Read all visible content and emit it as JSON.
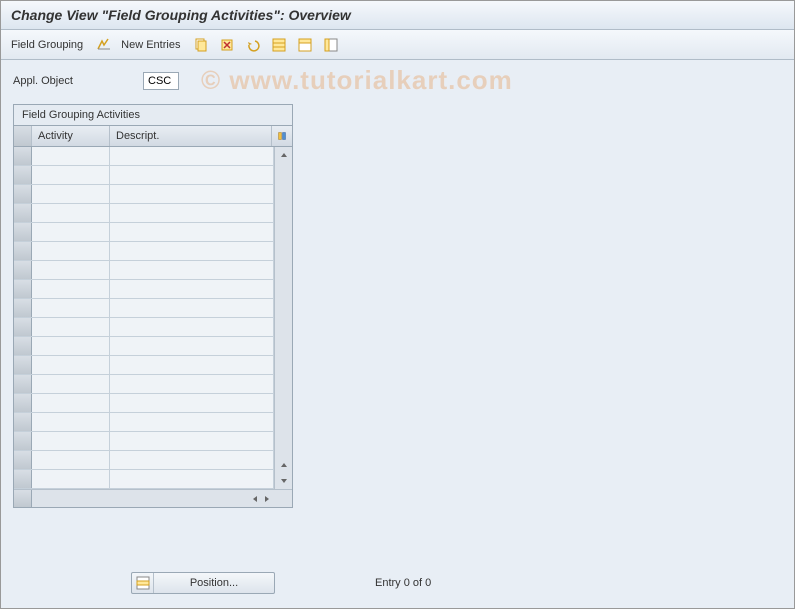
{
  "title": "Change View \"Field Grouping Activities\": Overview",
  "toolbar": {
    "field_grouping_label": "Field Grouping",
    "new_entries_label": "New Entries",
    "icons": {
      "toggle": "toggle-icon",
      "copy": "copy-icon",
      "delete": "delete-icon",
      "undo": "undo-icon",
      "select_all": "select-all-icon",
      "deselect": "deselect-icon",
      "config": "config-icon"
    }
  },
  "form": {
    "appl_object_label": "Appl. Object",
    "appl_object_value": "CSC"
  },
  "grid": {
    "title": "Field Grouping Activities",
    "columns": {
      "activity": "Activity",
      "descript": "Descript."
    },
    "row_count": 18
  },
  "footer": {
    "position_label": "Position...",
    "entry_text": "Entry 0 of 0"
  },
  "watermark": "© www.tutorialkart.com"
}
